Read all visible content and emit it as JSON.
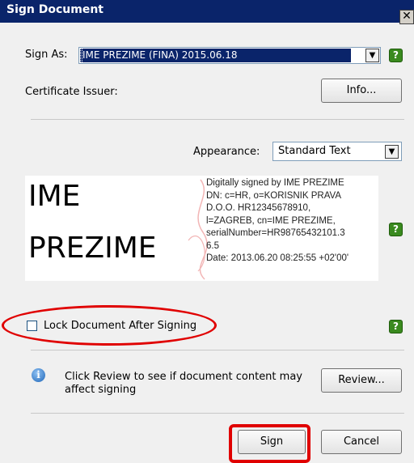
{
  "window": {
    "title": "Sign Document",
    "close_glyph": "✕"
  },
  "sign_as": {
    "label": "Sign As:",
    "value": "IME PREZIME (FINA) 2015.06.18"
  },
  "certificate": {
    "label": "Certificate Issuer:",
    "info_button": "Info..."
  },
  "appearance": {
    "label": "Appearance:",
    "value": "Standard Text"
  },
  "signature_preview": {
    "name_line1": "IME",
    "name_line2": "PREZIME",
    "details": "Digitally signed by IME PREZIME\nDN: c=HR, o=KORISNIK PRAVA\nD.O.O. HR12345678910,\nl=ZAGREB, cn=IME PREZIME,\nserialNumber=HR98765432101.3\n6.5\nDate: 2013.06.20 08:25:55 +02'00'"
  },
  "lock": {
    "label": "Lock Document After Signing",
    "checked": false
  },
  "review": {
    "message": "Click Review to see if document content may affect signing",
    "button": "Review..."
  },
  "footer": {
    "sign_button": "Sign",
    "cancel_button": "Cancel"
  },
  "help_glyph": "?",
  "info_glyph": "i",
  "colors": {
    "title_bar": "#0a246a",
    "highlight": "#e00000",
    "help": "#3a8a1f"
  }
}
